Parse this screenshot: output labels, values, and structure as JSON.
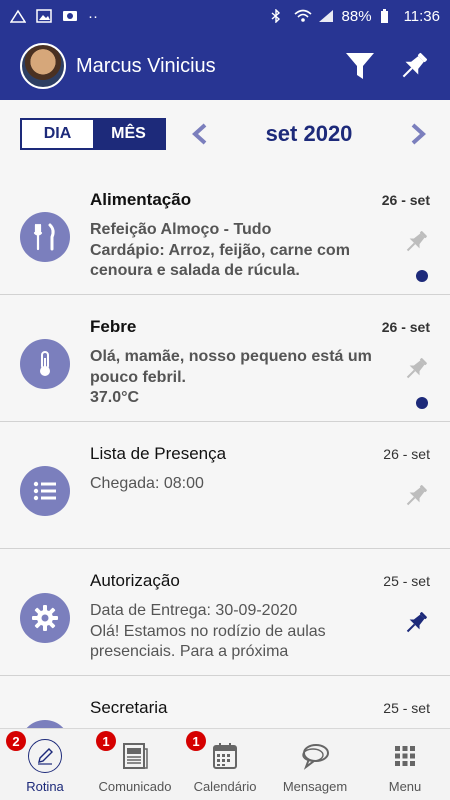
{
  "status_bar": {
    "battery": "88%",
    "time": "11:36"
  },
  "header": {
    "user_name": "Marcus Vinicius"
  },
  "view_toggle": {
    "day": "DIA",
    "month": "MÊS",
    "selected": "MÊS"
  },
  "period": {
    "label": "set 2020"
  },
  "items": [
    {
      "title": "Alimentação",
      "date": "26 - set",
      "line1": "Refeição Almoço - Tudo",
      "line2": "Cardápio: Arroz, feijão, carne com cenoura e salada de rúcula.",
      "icon": "utensils-icon",
      "unread": true,
      "pinned": false
    },
    {
      "title": "Febre",
      "date": "26 - set",
      "line1": "Olá, mamãe, nosso pequeno está um pouco febril.",
      "line2": "37.0°C",
      "icon": "thermometer-icon",
      "unread": true,
      "pinned": false
    },
    {
      "title": "Lista de Presença",
      "date": "26 - set",
      "line1": "Chegada: 08:00",
      "line2": "",
      "icon": "list-icon",
      "unread": false,
      "pinned": false
    },
    {
      "title": "Autorização",
      "date": "25 - set",
      "line1": "Data de Entrega: 30-09-2020",
      "line2": "Olá! Estamos no rodízio de aulas presenciais. Para a próxima",
      "icon": "gear-icon",
      "unread": false,
      "pinned": true
    },
    {
      "title": "Secretaria",
      "date": "25 - set",
      "line1": "",
      "line2": "",
      "icon": "office-icon",
      "unread": false,
      "pinned": false
    }
  ],
  "bottom_nav": [
    {
      "label": "Rotina",
      "badge": "2",
      "icon": "pencil-icon",
      "active": true
    },
    {
      "label": "Comunicado",
      "badge": "1",
      "icon": "newspaper-icon",
      "active": false
    },
    {
      "label": "Calendário",
      "badge": "1",
      "icon": "calendar-icon",
      "active": false
    },
    {
      "label": "Mensagem",
      "badge": "",
      "icon": "chat-icon",
      "active": false
    },
    {
      "label": "Menu",
      "badge": "",
      "icon": "grid-icon",
      "active": false
    }
  ],
  "colors": {
    "primary": "#283593",
    "dark_primary": "#1d2a7a",
    "icon_circle": "#7b7fbd",
    "badge": "#d50000"
  }
}
